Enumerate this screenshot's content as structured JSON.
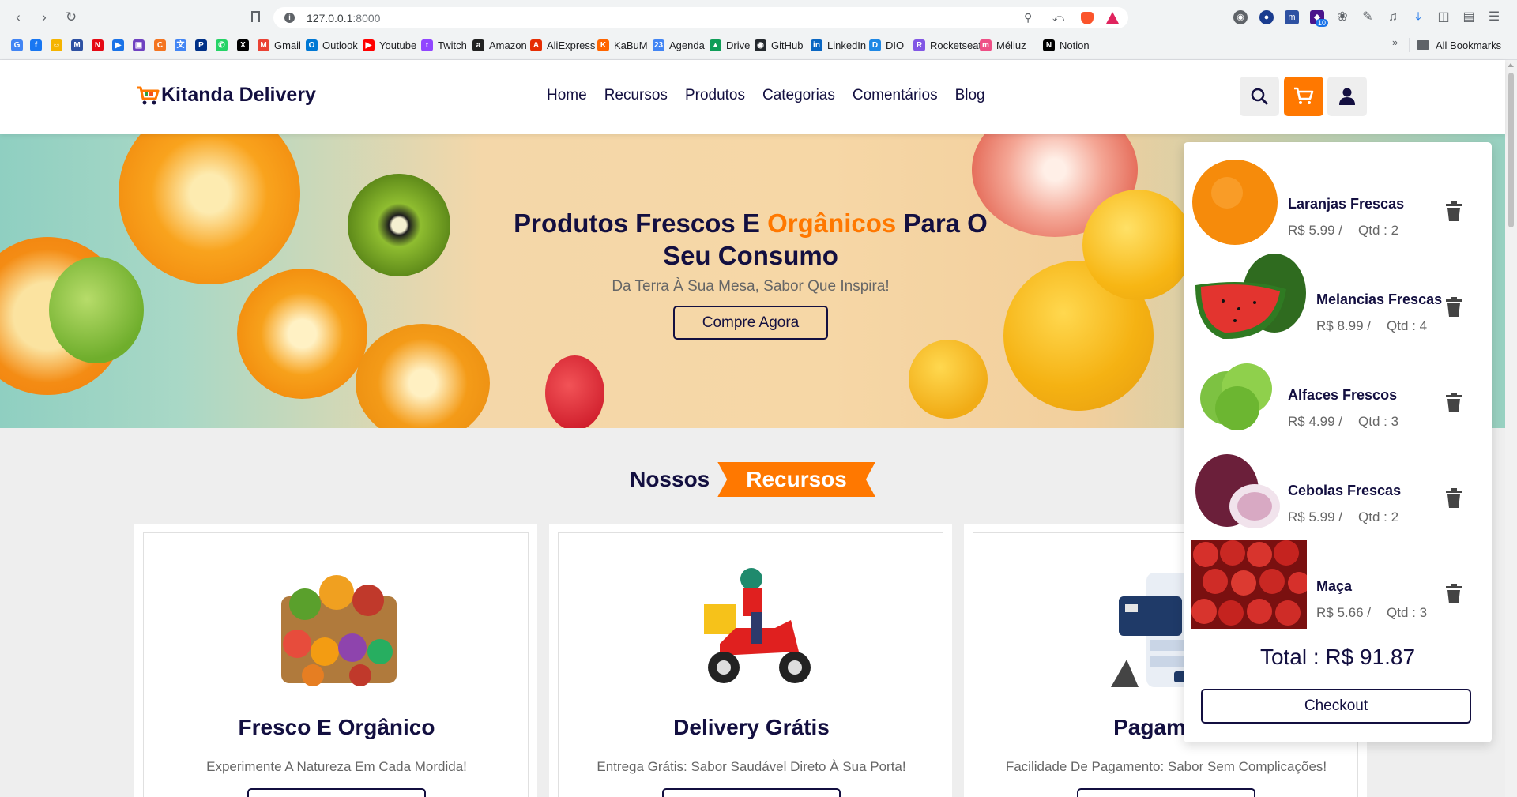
{
  "browser": {
    "url_host": "127.0.0.1",
    "url_port": ":8000",
    "extension_badge": "10",
    "bookmarks": [
      {
        "label": "",
        "icon": "google-icon",
        "color": "#4285f4"
      },
      {
        "label": "",
        "icon": "facebook-icon",
        "color": "#1877f2"
      },
      {
        "label": "",
        "icon": "emoji-icon",
        "color": "#f5b400"
      },
      {
        "label": "",
        "icon": "mal-icon",
        "color": "#2e51a2"
      },
      {
        "label": "",
        "icon": "netflix-icon",
        "color": "#e50914"
      },
      {
        "label": "",
        "icon": "play-icon",
        "color": "#1a73e8"
      },
      {
        "label": "",
        "icon": "tv-icon",
        "color": "#6f42c1"
      },
      {
        "label": "",
        "icon": "crunchyroll-icon",
        "color": "#f47521"
      },
      {
        "label": "",
        "icon": "translate-icon",
        "color": "#4285f4"
      },
      {
        "label": "",
        "icon": "paypal-icon",
        "color": "#003087"
      },
      {
        "label": "",
        "icon": "whatsapp-icon",
        "color": "#25d366"
      },
      {
        "label": "",
        "icon": "x-icon",
        "color": "#000000"
      },
      {
        "label": "Gmail",
        "icon": "gmail-icon",
        "color": "#ea4335"
      },
      {
        "label": "Outlook",
        "icon": "outlook-icon",
        "color": "#0078d4"
      },
      {
        "label": "Youtube",
        "icon": "youtube-icon",
        "color": "#ff0000"
      },
      {
        "label": "Twitch",
        "icon": "twitch-icon",
        "color": "#9146ff"
      },
      {
        "label": "Amazon",
        "icon": "amazon-icon",
        "color": "#222222"
      },
      {
        "label": "AliExpress",
        "icon": "aliexpress-icon",
        "color": "#e62e04"
      },
      {
        "label": "KaBuM",
        "icon": "kabum-icon",
        "color": "#ff6500"
      },
      {
        "label": "Agenda",
        "icon": "calendar-icon",
        "color": "#4285f4"
      },
      {
        "label": "Drive",
        "icon": "drive-icon",
        "color": "#0f9d58"
      },
      {
        "label": "GitHub",
        "icon": "github-icon",
        "color": "#24292e"
      },
      {
        "label": "LinkedIn",
        "icon": "linkedin-icon",
        "color": "#0a66c2"
      },
      {
        "label": "DIO",
        "icon": "dio-icon",
        "color": "#1e88e5"
      },
      {
        "label": "Rocketseat",
        "icon": "rocketseat-icon",
        "color": "#8257e5"
      },
      {
        "label": "Méliuz",
        "icon": "meliuz-icon",
        "color": "#ee4f86"
      },
      {
        "label": "Notion",
        "icon": "notion-icon",
        "color": "#000000"
      }
    ],
    "more_bookmarks": "»",
    "all_bookmarks": "All Bookmarks"
  },
  "site": {
    "logo_text": "Kitanda Delivery",
    "nav": [
      "Home",
      "Recursos",
      "Produtos",
      "Categorias",
      "Comentários",
      "Blog"
    ],
    "accent_color": "#ff7800",
    "primary_color": "#130f40"
  },
  "hero": {
    "title_part1": "Produtos Frescos E ",
    "title_accent": "Orgânicos",
    "title_part2": " Para O Seu Consumo",
    "subtitle": "Da Terra À Sua Mesa, Sabor Que Inspira!",
    "button": "Compre Agora"
  },
  "features": {
    "heading": "Nossos",
    "heading_tag": "Recursos",
    "cards": [
      {
        "title": "Fresco E Orgânico",
        "desc": "Experimente A Natureza Em Cada Mordida!"
      },
      {
        "title": "Delivery Grátis",
        "desc": "Entrega Grátis: Sabor Saudável Direto À Sua Porta!"
      },
      {
        "title": "Pagament",
        "desc": "Facilidade De Pagamento: Sabor Sem Complicações!"
      }
    ]
  },
  "cart": {
    "items": [
      {
        "name": "Laranjas Frescas",
        "price": "R$ 5.99 /",
        "qty": "Qtd : 2"
      },
      {
        "name": "Melancias Frescas",
        "price": "R$ 8.99 /",
        "qty": "Qtd : 4"
      },
      {
        "name": "Alfaces Frescos",
        "price": "R$ 4.99 /",
        "qty": "Qtd : 3"
      },
      {
        "name": "Cebolas Frescas",
        "price": "R$ 5.99 /",
        "qty": "Qtd : 2"
      },
      {
        "name": "Maça",
        "price": "R$ 5.66 /",
        "qty": "Qtd : 3"
      }
    ],
    "total": "Total : R$ 91.87",
    "checkout": "Checkout"
  }
}
